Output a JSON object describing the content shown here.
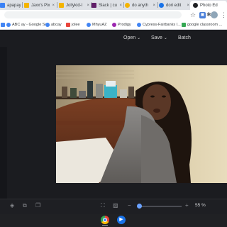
{
  "tabs": [
    {
      "label": "apapaya",
      "favicon_color": "#3b82f6"
    },
    {
      "label": "Jaxx's Pix",
      "favicon_color": "#f4b400"
    },
    {
      "label": "Jollykid-l",
      "favicon_color": "#f4b400"
    },
    {
      "label": "Slack | cu",
      "favicon_color": "#611f69"
    },
    {
      "label": "do anyth",
      "favicon_color": "#f4b400"
    },
    {
      "label": "dori edit",
      "favicon_color": "#1a73e8"
    },
    {
      "label": "Photo Ed",
      "favicon_color": "#202124",
      "active": true
    }
  ],
  "bookmarks": [
    {
      "label": "ABC ay - Google Se...",
      "favicon_color": "#4285f4"
    },
    {
      "label": "abcay",
      "favicon_color": "#4285f4"
    },
    {
      "label": "jolee",
      "favicon_color": "#e8453c"
    },
    {
      "label": "MhyuAZ",
      "favicon_color": "#4285f4"
    },
    {
      "label": "Prodigy",
      "favicon_color": "#9c27b0"
    },
    {
      "label": "Cypress-Fairbanks I...",
      "favicon_color": "#4285f4"
    },
    {
      "label": "google classroom ...",
      "favicon_color": "#34a853"
    }
  ],
  "toolbar": {
    "open_label": "Open",
    "save_label": "Save",
    "batch_label": "Batch",
    "caret": "⌄"
  },
  "zoom": {
    "label": "55 %",
    "value": 0.0
  },
  "colors": {
    "app_bg": "#1b1c20",
    "accent": "#6aa2ff"
  }
}
